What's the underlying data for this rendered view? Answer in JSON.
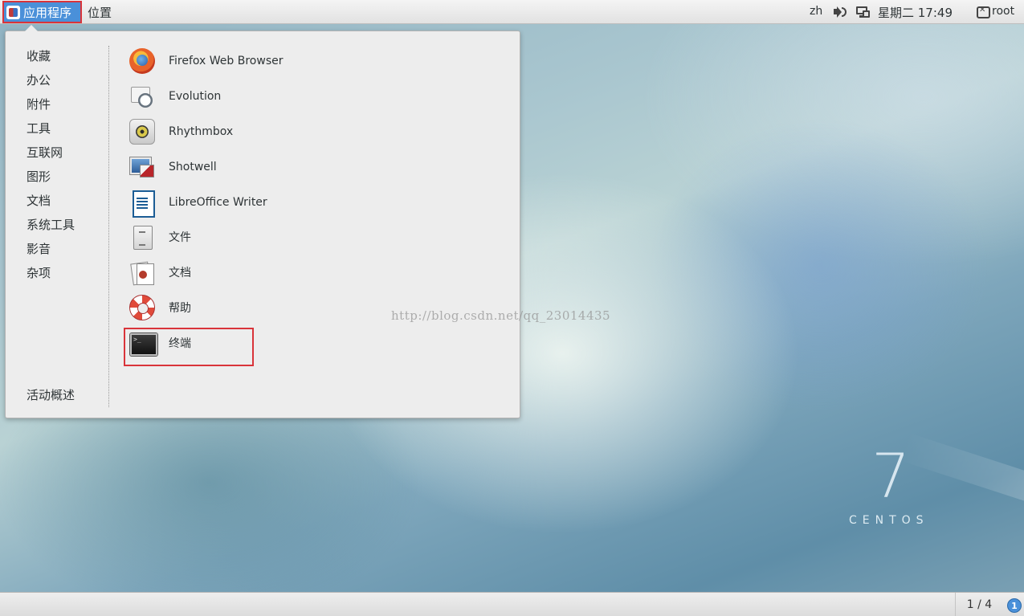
{
  "topbar": {
    "applications_label": "应用程序",
    "places_label": "位置",
    "input_method": "zh",
    "datetime": "星期二 17:49",
    "user": "root"
  },
  "menu": {
    "categories": [
      "收藏",
      "办公",
      "附件",
      "工具",
      "互联网",
      "图形",
      "文档",
      "系统工具",
      "影音",
      "杂项"
    ],
    "activities_overview": "活动概述",
    "apps": [
      {
        "name": "Firefox Web Browser",
        "icon": "firefox-icon"
      },
      {
        "name": "Evolution",
        "icon": "evolution-icon"
      },
      {
        "name": "Rhythmbox",
        "icon": "rhythmbox-icon"
      },
      {
        "name": "Shotwell",
        "icon": "shotwell-icon"
      },
      {
        "name": "LibreOffice Writer",
        "icon": "libreoffice-writer-icon"
      },
      {
        "name": "文件",
        "icon": "files-icon"
      },
      {
        "name": "文档",
        "icon": "documents-icon"
      },
      {
        "name": "帮助",
        "icon": "help-icon"
      },
      {
        "name": "终端",
        "icon": "terminal-icon"
      }
    ]
  },
  "watermark": "http://blog.csdn.net/qq_23014435",
  "desktop": {
    "logo_number": "7",
    "logo_text": "CENTOS"
  },
  "bottombar": {
    "workspace_pager": "1 / 4",
    "workspace_indicator": "1"
  },
  "colors": {
    "accent": "#4a90d9",
    "highlight_border": "#d9343a"
  }
}
